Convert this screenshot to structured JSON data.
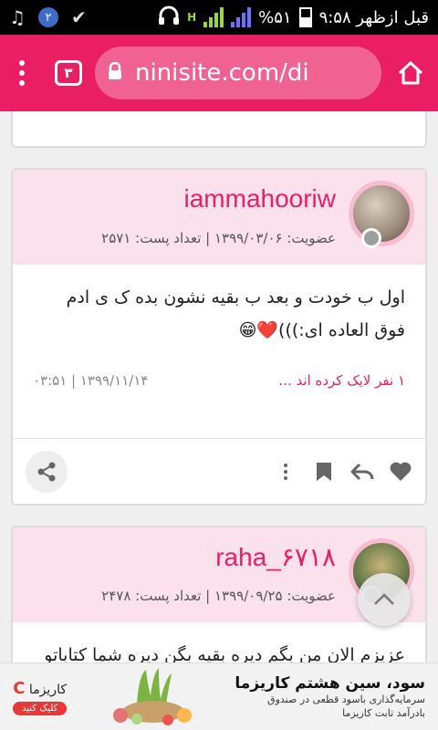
{
  "status_bar": {
    "notification_count": "۲",
    "network_label": "H",
    "battery_percent": "%۵۱",
    "time": "۹:۵۸ قبل ازظهر"
  },
  "toolbar": {
    "tab_count": "۳",
    "url": "ninisite.com/di"
  },
  "posts": [
    {
      "username": "iammahooriw",
      "meta": "عضویت: ۱۳۹۹/۰۳/۰۶ | تعداد پست: ۲۵۷۱",
      "body_line1": "اول ب خودت و بعد ب بقیه نشون بده ک ی ادم",
      "body_line2": "فوق العاده ای:)))❤️😁",
      "likes": "۱ نفر لایک کرده اند ...",
      "date": "۱۳۹۹/۱۱/۱۴ | ۰۳:۵۱"
    },
    {
      "username": "raha_۶۷۱۸",
      "meta": "عضویت: ۱۳۹۹/۰۹/۲۵ | تعداد پست: ۲۴۷۸",
      "body_line1": "عزیزم الان من بگم دیره بقیه بگن دیره شما کتاباتو"
    }
  ],
  "ad": {
    "brand": "کاریزما",
    "cta": "کلیک کنید",
    "title": "سود، سین هشتم کاریزما",
    "subtitle_line1": "سرمایه‌گذاری باسود قطعی در صندوق",
    "subtitle_line2": "بادرآمد ثابت کاریزما"
  },
  "colors": {
    "primary": "#e91e63",
    "header_bg": "#fbe1ec"
  }
}
